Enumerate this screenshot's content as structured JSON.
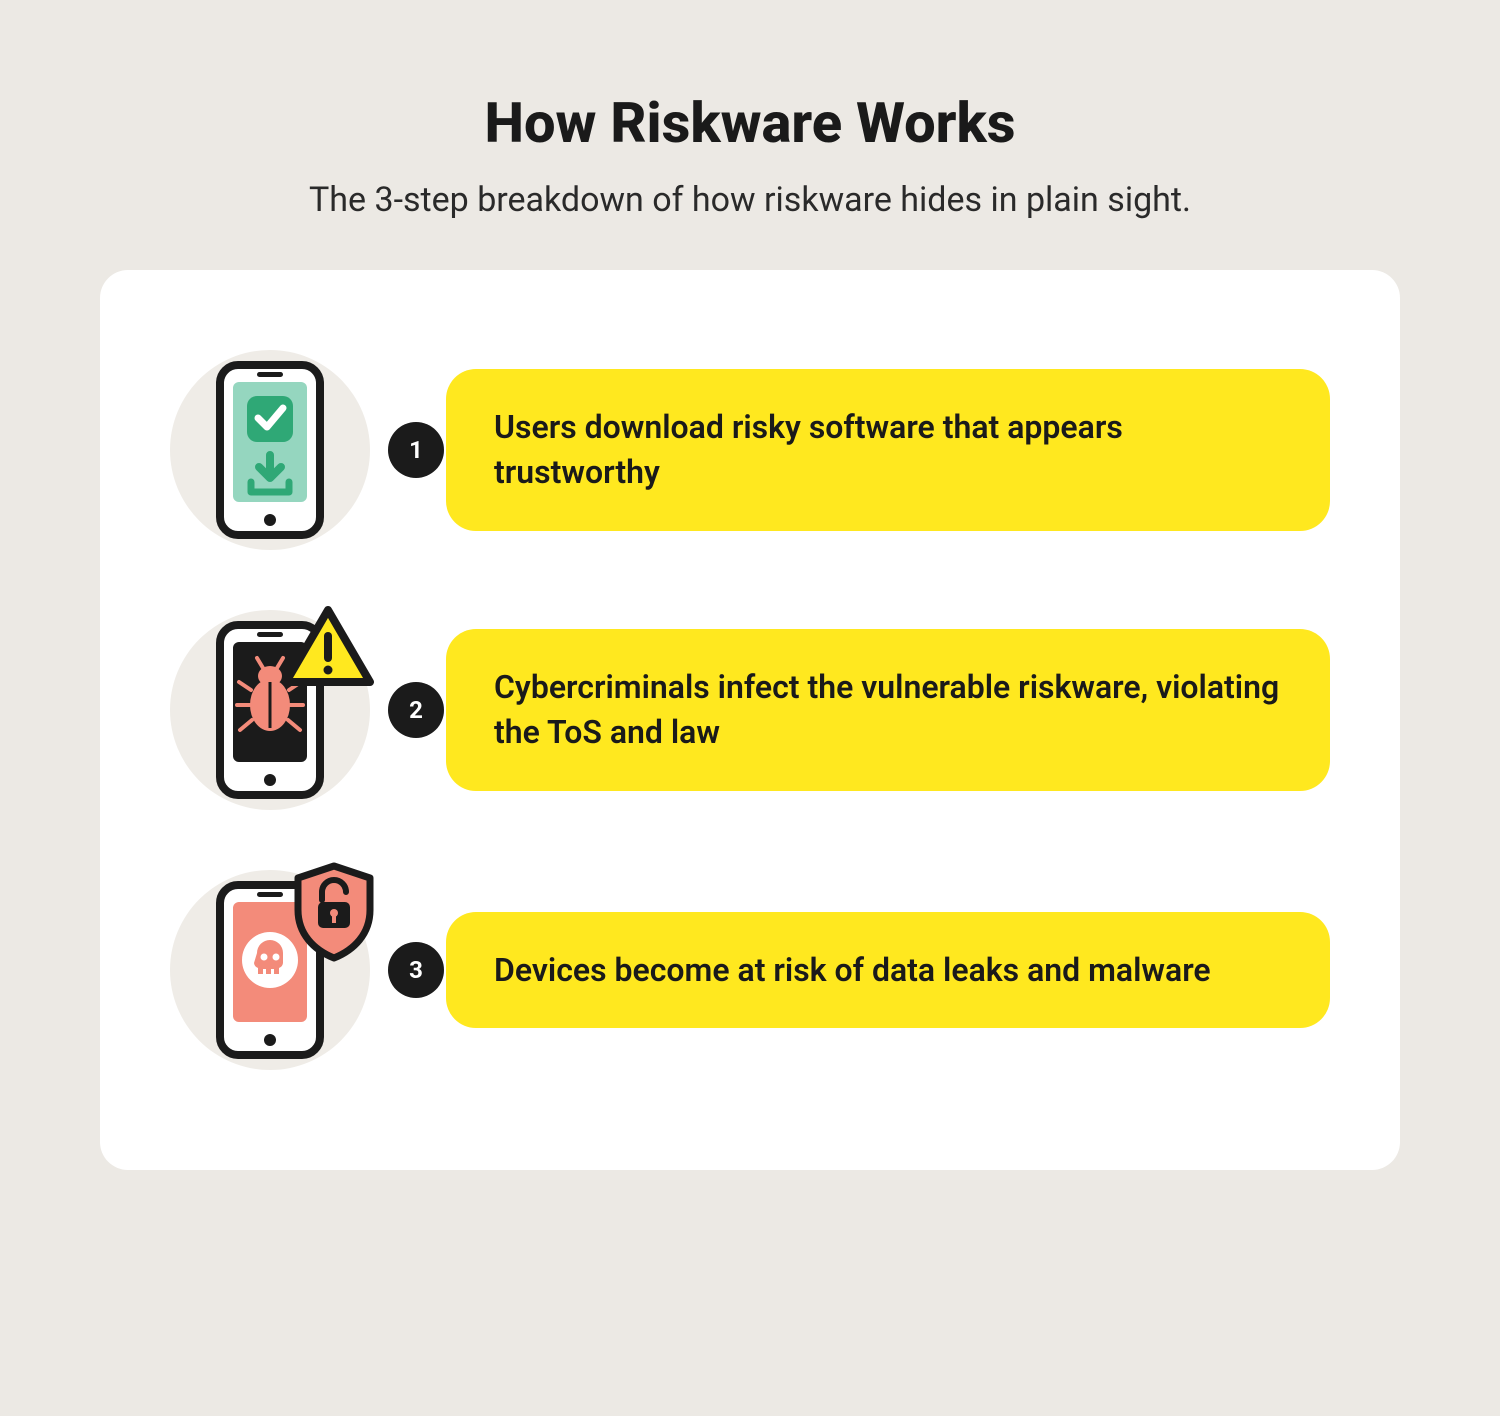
{
  "header": {
    "title": "How Riskware Works",
    "subtitle": "The 3-step breakdown of how riskware hides in plain sight."
  },
  "steps": [
    {
      "num": "1",
      "text": "Users download risky software that appears trustworthy"
    },
    {
      "num": "2",
      "text": "Cybercriminals infect the vulnerable riskware, violating the ToS and law"
    },
    {
      "num": "3",
      "text": "Devices become at risk of data leaks and malware"
    }
  ]
}
